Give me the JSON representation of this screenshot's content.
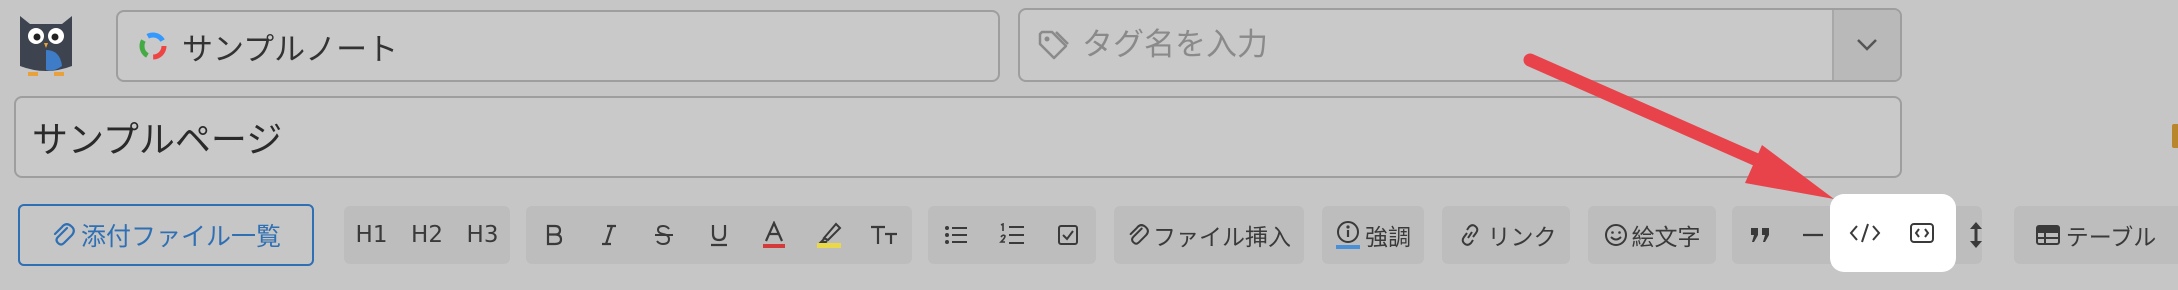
{
  "header": {
    "note_name": "サンプルノート",
    "tag_placeholder": "タグ名を入力"
  },
  "page": {
    "title": "サンプルページ"
  },
  "toolbar": {
    "attach_label": "添付ファイル一覧",
    "h1": "H1",
    "h2": "H2",
    "h3": "H3",
    "file_insert": "ファイル挿入",
    "emphasis": "強調",
    "link": "リンク",
    "emoji": "絵文字",
    "table": "テーブル"
  },
  "colors": {
    "accent_blue": "#2f6fb3",
    "arrow_red": "#e8434b",
    "text_color_underline": "#d43a3a",
    "highlighter_yellow": "#e8d84a"
  }
}
